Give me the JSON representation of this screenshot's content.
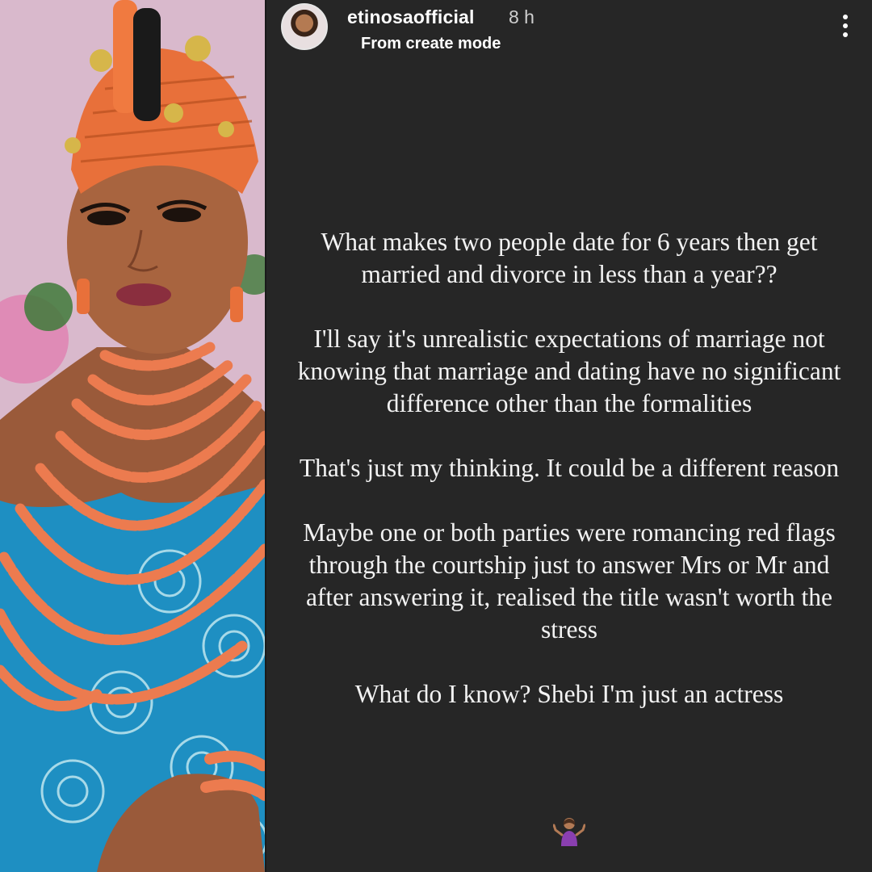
{
  "story": {
    "username": "etinosaofficial",
    "time_ago": "8 h",
    "subtitle": "From create mode",
    "more_icon": "more-vertical-icon",
    "paragraphs": [
      "What makes two people date for 6 years then get married and divorce in less than a year??",
      "I'll say it's unrealistic expectations of marriage not knowing that marriage and dating have no significant difference other than the formalities",
      "That's just my thinking. It could be a different reason",
      "Maybe one or both parties were romancing red flags through the courtship just to answer Mrs or Mr and after answering it, realised the title wasn't worth the stress",
      "What do I know? Shebi I'm just an actress"
    ],
    "emoji": "person-shrugging-emoji"
  },
  "colors": {
    "background": "#262626",
    "text": "#f2f2f2",
    "coral_beads": "#e8734a",
    "dress_blue": "#1f8fc0"
  }
}
